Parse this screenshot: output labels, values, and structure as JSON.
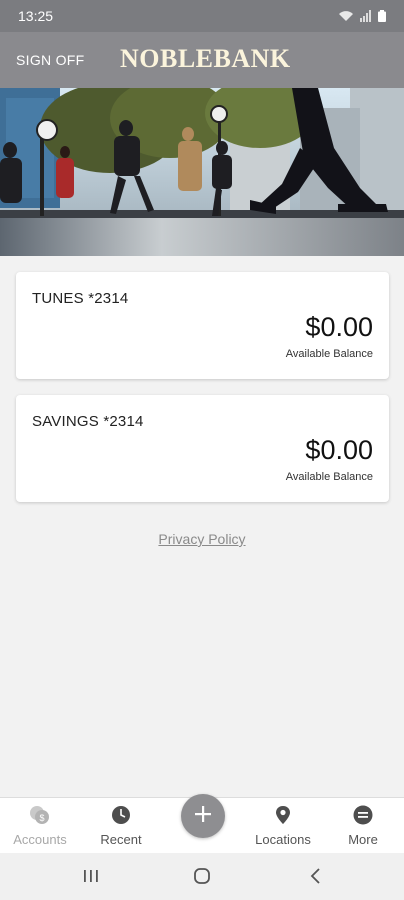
{
  "status": {
    "time": "13:25"
  },
  "header": {
    "sign_off": "SIGN OFF",
    "brand": "NOBLEBANK"
  },
  "accounts": [
    {
      "name": "TUNES *2314",
      "balance": "$0.00",
      "balance_label": "Available Balance"
    },
    {
      "name": "SAVINGS *2314",
      "balance": "$0.00",
      "balance_label": "Available Balance"
    }
  ],
  "privacy": {
    "label": "Privacy Policy"
  },
  "nav": {
    "accounts": "Accounts",
    "recent": "Recent",
    "locations": "Locations",
    "more": "More"
  },
  "colors": {
    "header_bg": "#8a8a8e",
    "status_bg": "#7b7c80",
    "brand_text": "#fbf4dc",
    "fab_bg": "#8e8e91"
  }
}
